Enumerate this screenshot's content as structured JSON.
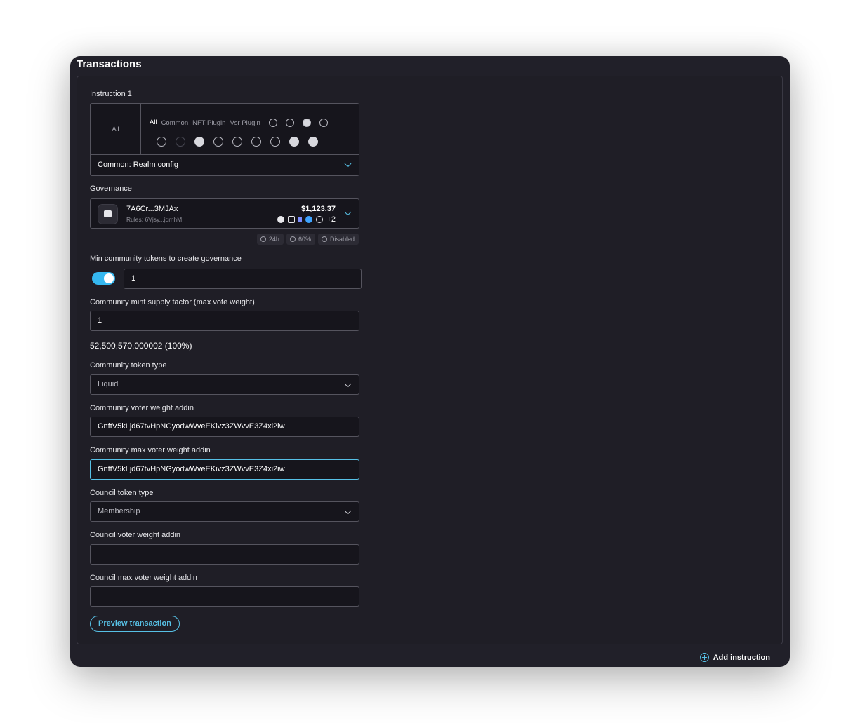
{
  "title": "Transactions",
  "instruction": {
    "label": "Instruction 1",
    "picker_left": "All",
    "tabs": [
      "All",
      "Common",
      "NFT Plugin",
      "Vsr Plugin"
    ],
    "selected": "Common: Realm config"
  },
  "governance": {
    "label": "Governance",
    "name": "7A6Cr...3MJAx",
    "rules": "Rules: 6Vjsy...jqmhM",
    "value": "$1,123.37",
    "extra_tokens": "+2",
    "pills": [
      "24h",
      "60%",
      "Disabled"
    ]
  },
  "min_tokens": {
    "label": "Min community tokens to create governance",
    "value": "1",
    "enabled": true
  },
  "mint_factor": {
    "label": "Community mint supply factor (max vote weight)",
    "value": "1"
  },
  "supply_text": "52,500,570.000002 (100%)",
  "community_token_type": {
    "label": "Community token type",
    "value": "Liquid"
  },
  "community_voter_addin": {
    "label": "Community voter weight addin",
    "value": "GnftV5kLjd67tvHpNGyodwWveEKivz3ZWvvE3Z4xi2iw"
  },
  "community_max_addin": {
    "label": "Community max voter weight addin",
    "value": "GnftV5kLjd67tvHpNGyodwWveEKivz3ZWvvE3Z4xi2iw"
  },
  "council_token_type": {
    "label": "Council token type",
    "value": "Membership"
  },
  "council_voter_addin": {
    "label": "Council voter weight addin",
    "value": ""
  },
  "council_max_addin": {
    "label": "Council max voter weight addin",
    "value": ""
  },
  "preview_button": "Preview transaction",
  "add_instruction": "Add instruction",
  "colors": {
    "accent": "#57c1e6",
    "toggle": "#35b8f0",
    "background": "#212029"
  }
}
